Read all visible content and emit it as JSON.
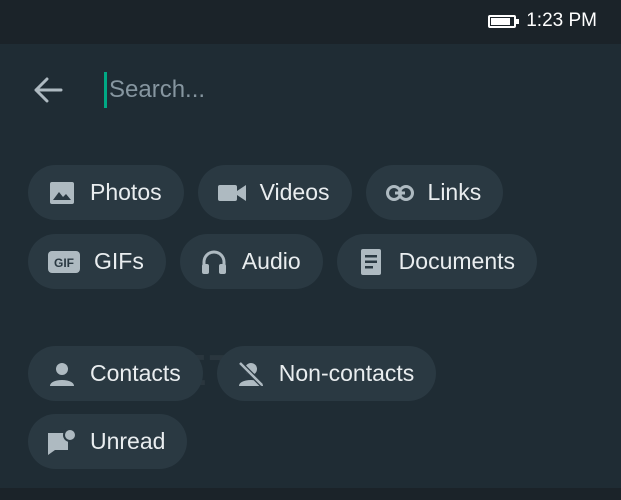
{
  "status_bar": {
    "time": "1:23 PM"
  },
  "search": {
    "placeholder": "Search..."
  },
  "filters": {
    "row1": [
      {
        "label": "Photos",
        "icon": "image-icon"
      },
      {
        "label": "Videos",
        "icon": "videocam-icon"
      },
      {
        "label": "Links",
        "icon": "link-icon"
      }
    ],
    "row2": [
      {
        "label": "GIFs",
        "icon": "gif-icon"
      },
      {
        "label": "Audio",
        "icon": "headphones-icon"
      },
      {
        "label": "Documents",
        "icon": "document-icon"
      }
    ],
    "row3": [
      {
        "label": "Contacts",
        "icon": "person-icon"
      },
      {
        "label": "Non-contacts",
        "icon": "person-off-icon"
      }
    ],
    "row4": [
      {
        "label": "Unread",
        "icon": "unread-chat-icon"
      }
    ]
  },
  "watermark": "©WABETAINFO",
  "colors": {
    "background": "#1f2c34",
    "chip": "#2a3942",
    "accent": "#00a884",
    "text": "#e9edef",
    "muted": "#8696a0"
  }
}
